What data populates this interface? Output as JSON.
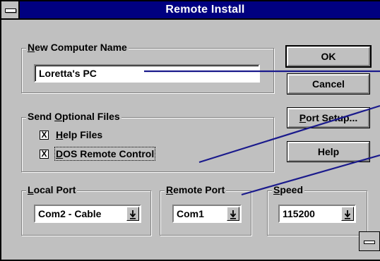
{
  "window": {
    "title": "Remote Install"
  },
  "new_computer_name": {
    "label_prefix": "",
    "label_hotkey": "N",
    "label_rest": "ew Computer Name",
    "value": "Loretta's PC"
  },
  "buttons": {
    "ok": "OK",
    "cancel": "Cancel",
    "port_setup_hotkey": "P",
    "port_setup_rest": "ort Setup...",
    "help": "Help"
  },
  "optional_files": {
    "label_before": "Send ",
    "label_hotkey": "O",
    "label_rest": "ptional Files",
    "items": [
      {
        "checked": "X",
        "hotkey": "H",
        "rest": "elp Files"
      },
      {
        "checked": "X",
        "hotkey": "D",
        "rest": "OS Remote Control"
      }
    ]
  },
  "local_port": {
    "hotkey": "L",
    "rest": "ocal Port",
    "value": "Com2 - Cable"
  },
  "remote_port": {
    "hotkey": "R",
    "rest": "emote Port",
    "value": "Com1"
  },
  "speed": {
    "hotkey": "S",
    "rest": "peed",
    "value": "115200"
  },
  "colors": {
    "titlebar": "#000080",
    "face": "#c0c0c0",
    "callout_line": "#1a1a8c"
  }
}
